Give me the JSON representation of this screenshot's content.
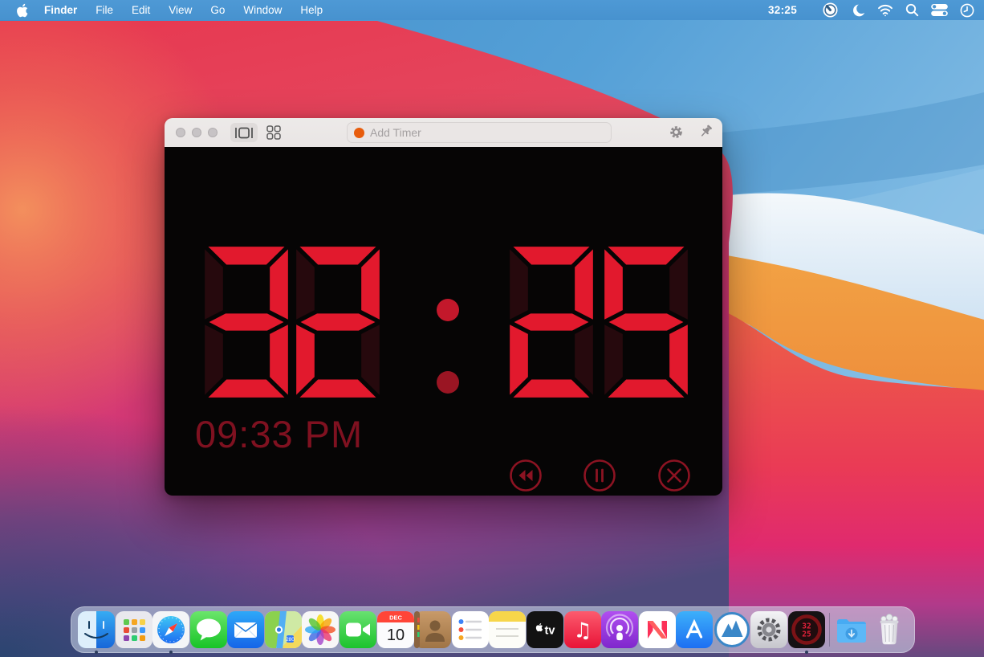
{
  "menu_bar": {
    "app_name": "Finder",
    "menus": [
      "File",
      "Edit",
      "View",
      "Go",
      "Window",
      "Help"
    ],
    "status": {
      "timer_text": "32:25",
      "icons": [
        "timer",
        "do-not-disturb",
        "wifi",
        "search",
        "control-center",
        "clock"
      ]
    }
  },
  "timer_window": {
    "toolbar": {
      "traffic_lights": [
        "close",
        "minimize",
        "zoom"
      ],
      "view_buttons": [
        "single-view",
        "grid-view"
      ],
      "add_timer_placeholder": "Add Timer",
      "actions": [
        "settings",
        "pin"
      ]
    },
    "display": {
      "digits": [
        "3",
        "2",
        "2",
        "5"
      ],
      "separator": ":",
      "ampm_time": "09:33 PM",
      "controls": [
        "restart",
        "pause",
        "close"
      ]
    },
    "colors": {
      "segment_lit": "#e2192d",
      "segment_ghost": "#26090d",
      "colon_top": "#c3182b",
      "colon_bottom": "#9a1523",
      "control_red": "#8c1322",
      "clock_text": "#7f1120",
      "display_bg": "#060505"
    }
  },
  "dock": {
    "items": [
      {
        "name": "finder",
        "running": true
      },
      {
        "name": "launchpad",
        "running": false
      },
      {
        "name": "safari",
        "running": true
      },
      {
        "name": "messages",
        "running": false
      },
      {
        "name": "mail",
        "running": false
      },
      {
        "name": "maps",
        "running": false
      },
      {
        "name": "photos",
        "running": false
      },
      {
        "name": "facetime",
        "running": false
      },
      {
        "name": "calendar",
        "running": false,
        "month": "DEC",
        "day": "10"
      },
      {
        "name": "contacts",
        "running": false
      },
      {
        "name": "reminders",
        "running": false
      },
      {
        "name": "notes",
        "running": false
      },
      {
        "name": "apple-tv",
        "running": false,
        "label": "tv"
      },
      {
        "name": "music",
        "running": false
      },
      {
        "name": "podcasts",
        "running": false
      },
      {
        "name": "news",
        "running": false
      },
      {
        "name": "app-store",
        "running": false
      },
      {
        "name": "amphetamine",
        "running": false
      },
      {
        "name": "system-preferences",
        "running": false
      },
      {
        "name": "timer",
        "running": true,
        "top": "32",
        "bottom": "25"
      },
      {
        "name": "divider"
      },
      {
        "name": "downloads",
        "running": false
      },
      {
        "name": "trash",
        "running": false
      }
    ]
  }
}
